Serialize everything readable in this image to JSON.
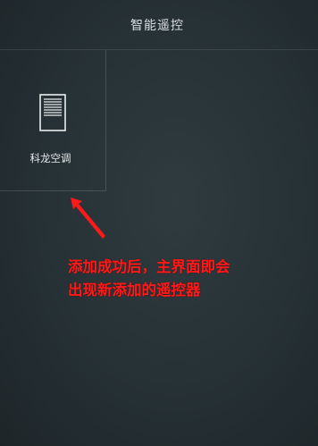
{
  "header": {
    "title": "智能遥控"
  },
  "devices": [
    {
      "name": "科龙空调",
      "icon": "air-conditioner-icon"
    }
  ],
  "annotation": {
    "line1": "添加成功后，主界面即会",
    "line2": "出现新添加的遥控器",
    "color": "#ff1a1a",
    "arrow_icon": "arrow-up-left-icon"
  },
  "colors": {
    "background": "#263135",
    "text": "#e6eaeb",
    "annotation": "#ff1a1a"
  }
}
